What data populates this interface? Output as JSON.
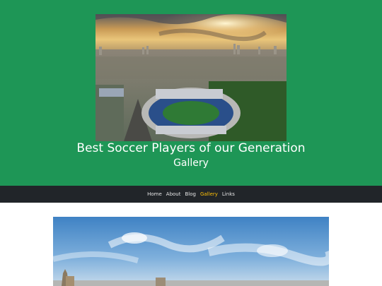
{
  "header": {
    "title": "Best Soccer Players of our Generation",
    "subtitle": "Gallery",
    "background_color": "#1e9656",
    "hero_image": "aerial-stadium-city-sunset"
  },
  "nav": {
    "background_color": "#212529",
    "active_color": "#ffc107",
    "items": [
      {
        "label": "Home",
        "active": false
      },
      {
        "label": "About",
        "active": false
      },
      {
        "label": "Blog",
        "active": false
      },
      {
        "label": "Gallery",
        "active": true
      },
      {
        "label": "Links",
        "active": false
      }
    ]
  },
  "gallery": {
    "images": [
      "sky-city-skyline"
    ]
  }
}
